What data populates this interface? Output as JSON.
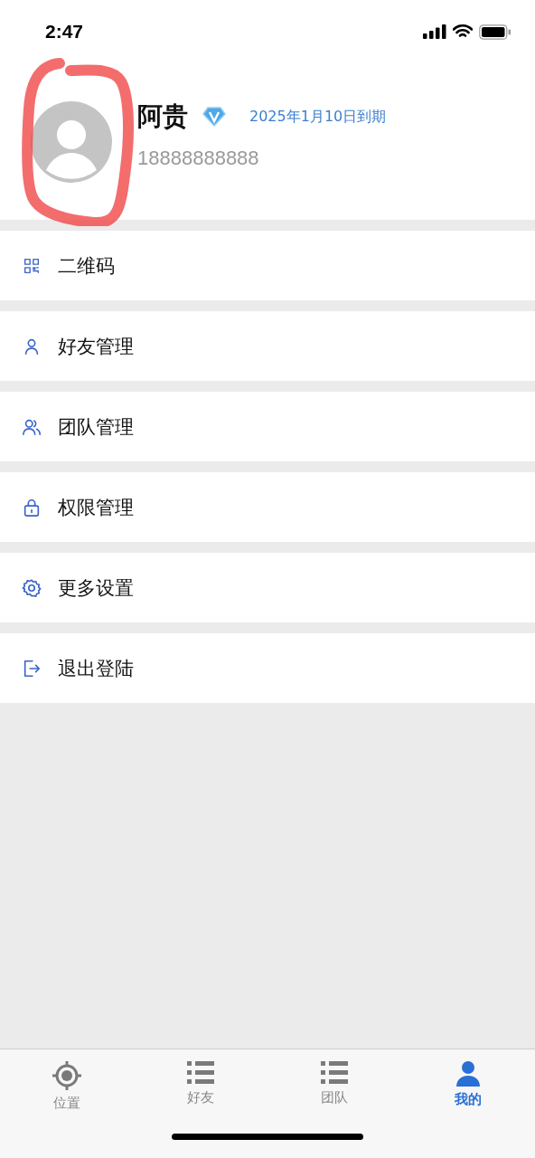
{
  "status_bar": {
    "time": "2:47"
  },
  "profile": {
    "name": "阿贵",
    "expiry": "2025年1月10日到期",
    "phone": "18888888888"
  },
  "menu": [
    {
      "label": "二维码",
      "kind": "qrcode"
    },
    {
      "label": "好友管理",
      "kind": "friend"
    },
    {
      "label": "团队管理",
      "kind": "team"
    },
    {
      "label": "权限管理",
      "kind": "lock"
    },
    {
      "label": "更多设置",
      "kind": "settings"
    },
    {
      "label": "退出登陆",
      "kind": "logout"
    }
  ],
  "tabs": [
    {
      "label": "位置",
      "kind": "location",
      "selected": false
    },
    {
      "label": "好友",
      "kind": "list",
      "selected": false
    },
    {
      "label": "团队",
      "kind": "list",
      "selected": false
    },
    {
      "label": "我的",
      "kind": "person",
      "selected": true
    }
  ]
}
